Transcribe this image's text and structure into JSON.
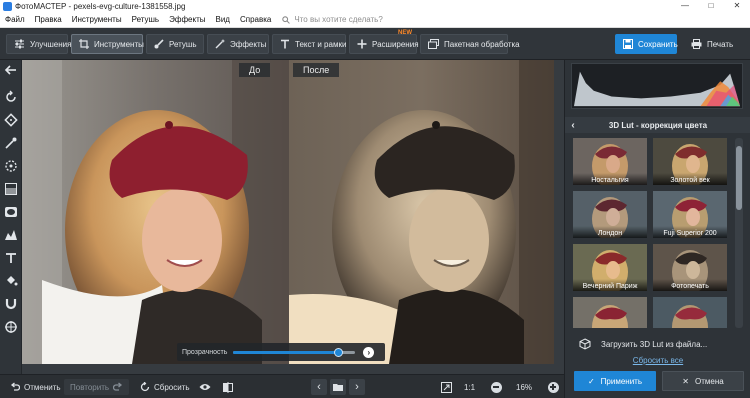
{
  "window": {
    "title": "ФотоМАСТЕР - pexels-evg-culture-1381558.jpg"
  },
  "menu": {
    "items": [
      "Файл",
      "Правка",
      "Инструменты",
      "Ретушь",
      "Эффекты",
      "Вид",
      "Справка"
    ],
    "search_placeholder": "Что вы хотите сделать?"
  },
  "toolbar": {
    "tabs": [
      "Улучшения",
      "Инструменты",
      "Ретушь",
      "Эффекты",
      "Текст и рамки",
      "Расширения",
      "Пакетная обработка"
    ],
    "new_badge": "NEW",
    "save": "Сохранить",
    "print": "Печать"
  },
  "canvas": {
    "before_label": "До",
    "after_label": "После",
    "opacity_label": "Прозрачность",
    "opacity_value": 0.86
  },
  "panel": {
    "title": "3D Lut - коррекция цвета",
    "luts": [
      "Ностальгия",
      "Золотой век",
      "Лондон",
      "Fuji Superior 200",
      "Вечерний Париж",
      "Фотопечать",
      "",
      ""
    ],
    "load_lut": "Загрузить 3D Lut из файла...",
    "reset_all": "Сбросить все",
    "apply": "Применить",
    "cancel": "Отмена"
  },
  "bottom": {
    "undo": "Отменить",
    "redo": "Повторить",
    "reset": "Сбросить",
    "ratio": "1:1",
    "zoom": "16%"
  },
  "colors": {
    "accent": "#1f86d6",
    "new_badge": "#ff8a2a",
    "link": "#7ab8ea"
  }
}
